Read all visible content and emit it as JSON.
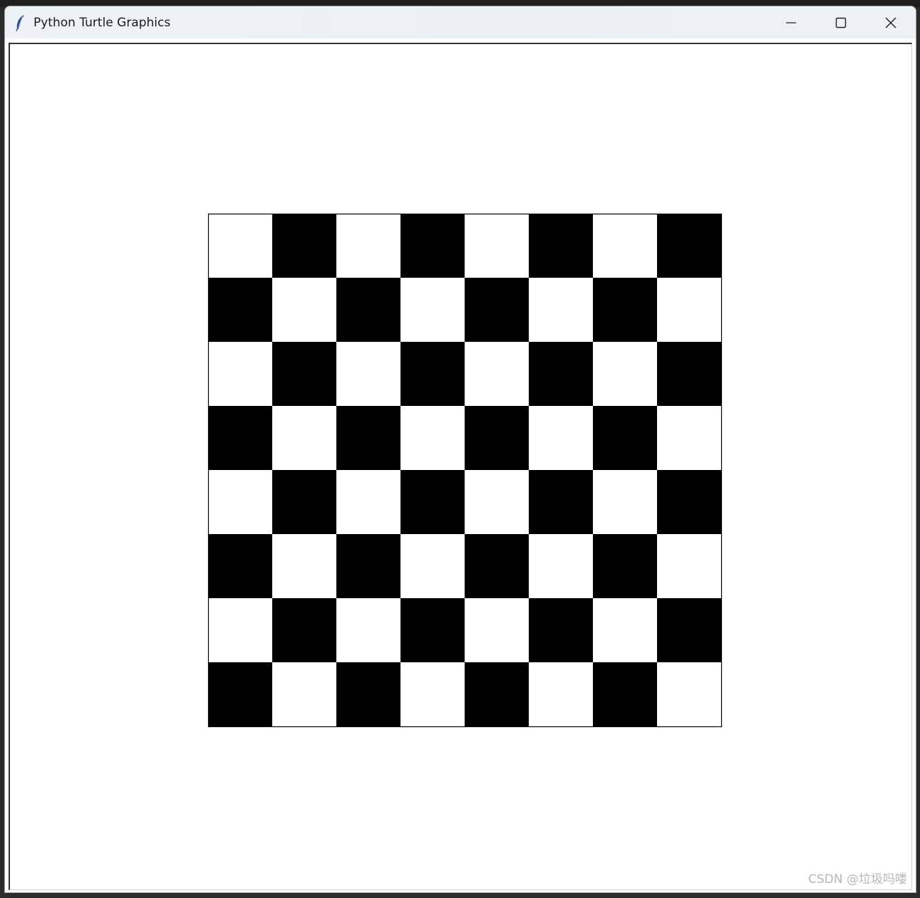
{
  "window": {
    "title": "Python Turtle Graphics",
    "app_icon": "feather-icon"
  },
  "caption_buttons": {
    "minimize_icon": "minimize-icon",
    "maximize_icon": "maximize-icon",
    "close_icon": "close-icon"
  },
  "board": {
    "rows": 8,
    "cols": 8,
    "top_left_color": "white",
    "dark_color": "#000000",
    "light_color": "#ffffff",
    "outline_color": "#000000"
  },
  "watermark": {
    "text": "CSDN @垃圾吗喽"
  }
}
